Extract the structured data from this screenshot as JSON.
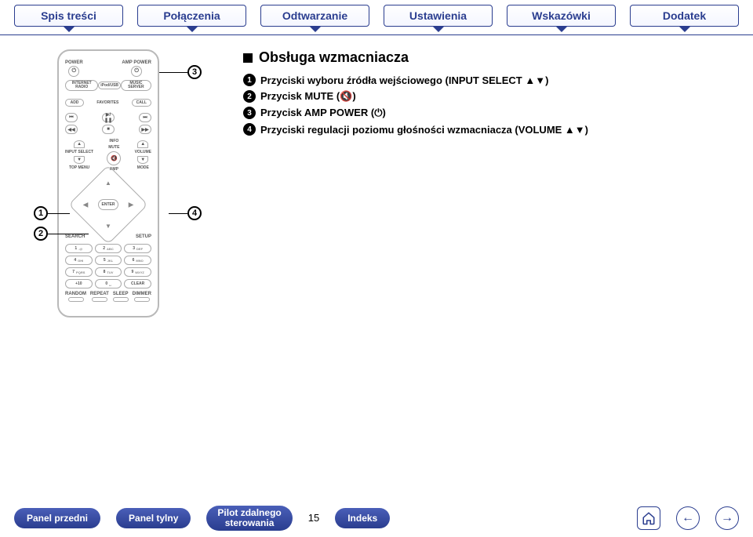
{
  "nav": {
    "tabs": [
      "Spis treści",
      "Połączenia",
      "Odtwarzanie",
      "Ustawienia",
      "Wskazówki",
      "Dodatek"
    ]
  },
  "section": {
    "title": "Obsługa wzmacniacza",
    "items": [
      "Przyciski wyboru źródła wejściowego (INPUT SELECT ▲▼)",
      "Przycisk MUTE (🔇)",
      "Przycisk AMP POWER (⏻)",
      "Przyciski regulacji poziomu głośności wzmacniacza (VOLUME ▲▼)"
    ]
  },
  "remote": {
    "power": "POWER",
    "amp_power": "AMP POWER",
    "internet_radio": "INTERNET RADIO",
    "ipod_usb": "iPod/USB",
    "music_server": "MUSIC SERVER",
    "add": "ADD",
    "favorites": "FAVORITES",
    "call": "CALL",
    "info": "INFO",
    "input_select": "INPUT SELECT",
    "mute": "MUTE",
    "volume": "VOLUME",
    "amp": "AMP",
    "top_menu": "TOP MENU",
    "mode": "MODE",
    "enter": "ENTER",
    "search": "SEARCH",
    "setup": "SETUP",
    "keys": [
      {
        "n": "1",
        "s": ".@"
      },
      {
        "n": "2",
        "s": "ABC"
      },
      {
        "n": "3",
        "s": "DEF"
      },
      {
        "n": "4",
        "s": "GHI"
      },
      {
        "n": "5",
        "s": "JKL"
      },
      {
        "n": "6",
        "s": "MNO"
      },
      {
        "n": "7",
        "s": "PQRS"
      },
      {
        "n": "8",
        "s": "TUV"
      },
      {
        "n": "9",
        "s": "WXYZ"
      },
      {
        "n": "+10",
        "s": ""
      },
      {
        "n": "0",
        "s": "␣"
      },
      {
        "n": "CLEAR",
        "s": ""
      }
    ],
    "random": "RANDOM",
    "repeat": "REPEAT",
    "sleep": "SLEEP",
    "dimmer": "DIMMER"
  },
  "callouts": {
    "c1": "1",
    "c2": "2",
    "c3": "3",
    "c4": "4"
  },
  "footer": {
    "front": "Panel przedni",
    "rear": "Panel tylny",
    "remote_l1": "Pilot zdalnego",
    "remote_l2": "sterowania",
    "page": "15",
    "index": "Indeks"
  }
}
